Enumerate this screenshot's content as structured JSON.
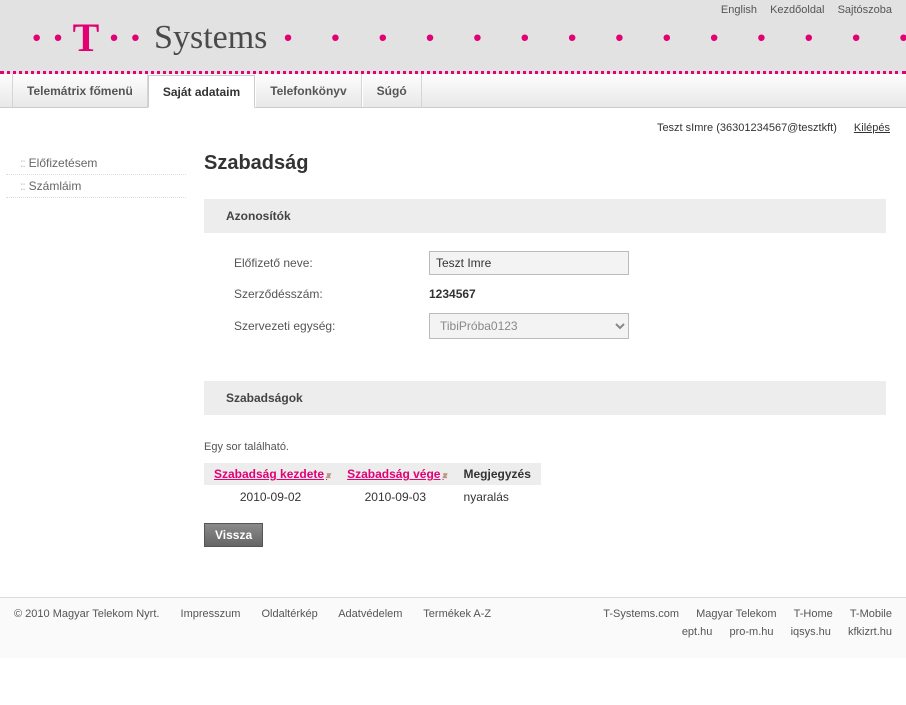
{
  "topLinks": {
    "english": "English",
    "home": "Kezdőoldal",
    "press": "Sajtószoba"
  },
  "brand": {
    "systems": "Systems"
  },
  "tabs": {
    "t0": "Telemátrix főmenü",
    "t1": "Saját adataim",
    "t2": "Telefonkönyv",
    "t3": "Súgó"
  },
  "user": {
    "display": "Teszt  sImre (36301234567@tesztkft)",
    "logout": "Kilépés"
  },
  "sidebar": {
    "sub": "Előfizetésem",
    "bills": "Számláim"
  },
  "page": {
    "title": "Szabadság"
  },
  "ids": {
    "header": "Azonosítók",
    "subscriberLabel": "Előfizető neve:",
    "subscriberValue": "Teszt Imre",
    "contractLabel": "Szerződésszám:",
    "contractValue": "1234567",
    "orgLabel": "Szervezeti egység:",
    "orgValue": "TibiPróba0123"
  },
  "vac": {
    "header": "Szabadságok",
    "resultNote": "Egy sor található.",
    "colStart": "Szabadság kezdete",
    "colEnd": "Szabadság vége",
    "colNote": "Megjegyzés",
    "rowStart": "2010-09-02",
    "rowEnd": "2010-09-03",
    "rowNote": "nyaralás"
  },
  "buttons": {
    "back": "Vissza"
  },
  "footer": {
    "copyright": "© 2010 Magyar Telekom Nyrt.",
    "impressum": "Impresszum",
    "sitemap": "Oldaltérkép",
    "privacy": "Adatvédelem",
    "products": "Termékek A-Z",
    "r1a": "T-Systems.com",
    "r1b": "Magyar Telekom",
    "r1c": "T-Home",
    "r1d": "T-Mobile",
    "r2a": "ept.hu",
    "r2b": "pro-m.hu",
    "r2c": "iqsys.hu",
    "r2d": "kfkizrt.hu"
  }
}
